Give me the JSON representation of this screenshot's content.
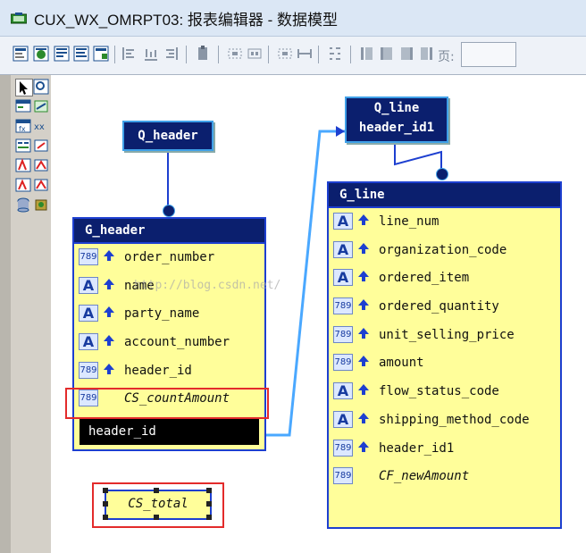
{
  "window": {
    "title": "CUX_WX_OMRPT03: 报表编辑器 - 数据模型",
    "icon": "report-builder-icon"
  },
  "toolbar": {
    "page_label": "页:",
    "page_value": ""
  },
  "queries": {
    "q_header": {
      "label": "Q_header"
    },
    "q_line": {
      "label": "Q_line",
      "field": "header_id1"
    }
  },
  "g_header": {
    "title": "G_header",
    "fields": [
      {
        "name": "order_number",
        "type": "number-icon",
        "italic": false
      },
      {
        "name": "name",
        "type": "alpha-icon",
        "italic": false
      },
      {
        "name": "party_name",
        "type": "alpha-icon",
        "italic": false
      },
      {
        "name": "account_number",
        "type": "alpha-icon",
        "italic": false
      },
      {
        "name": "header_id",
        "type": "number-icon",
        "italic": false
      },
      {
        "name": "CS_countAmount",
        "type": "number-icon",
        "italic": true
      }
    ],
    "link_field": "header_id"
  },
  "g_line": {
    "title": "G_line",
    "fields": [
      {
        "name": "line_num",
        "type": "alpha-icon",
        "italic": false
      },
      {
        "name": "organization_code",
        "type": "alpha-icon",
        "italic": false
      },
      {
        "name": "ordered_item",
        "type": "alpha-icon",
        "italic": false
      },
      {
        "name": "ordered_quantity",
        "type": "number-icon",
        "italic": false
      },
      {
        "name": "unit_selling_price",
        "type": "number-icon",
        "italic": false
      },
      {
        "name": "amount",
        "type": "number-icon",
        "italic": false
      },
      {
        "name": "flow_status_code",
        "type": "alpha-icon",
        "italic": false
      },
      {
        "name": "shipping_method_code",
        "type": "alpha-icon",
        "italic": false
      },
      {
        "name": "header_id1",
        "type": "number-icon",
        "italic": false
      },
      {
        "name": "CF_newAmount",
        "type": "number-icon",
        "italic": true
      }
    ]
  },
  "summary": {
    "cs_total": "CS_total"
  },
  "icon_text": {
    "number": "789",
    "alpha": "A"
  },
  "watermark": "http://blog.csdn.net/",
  "colors": {
    "group_fill": "#fffe9a",
    "group_border": "#1d3fd0",
    "header_fill": "#0b1f6e",
    "highlight_red": "#e32b2b"
  }
}
